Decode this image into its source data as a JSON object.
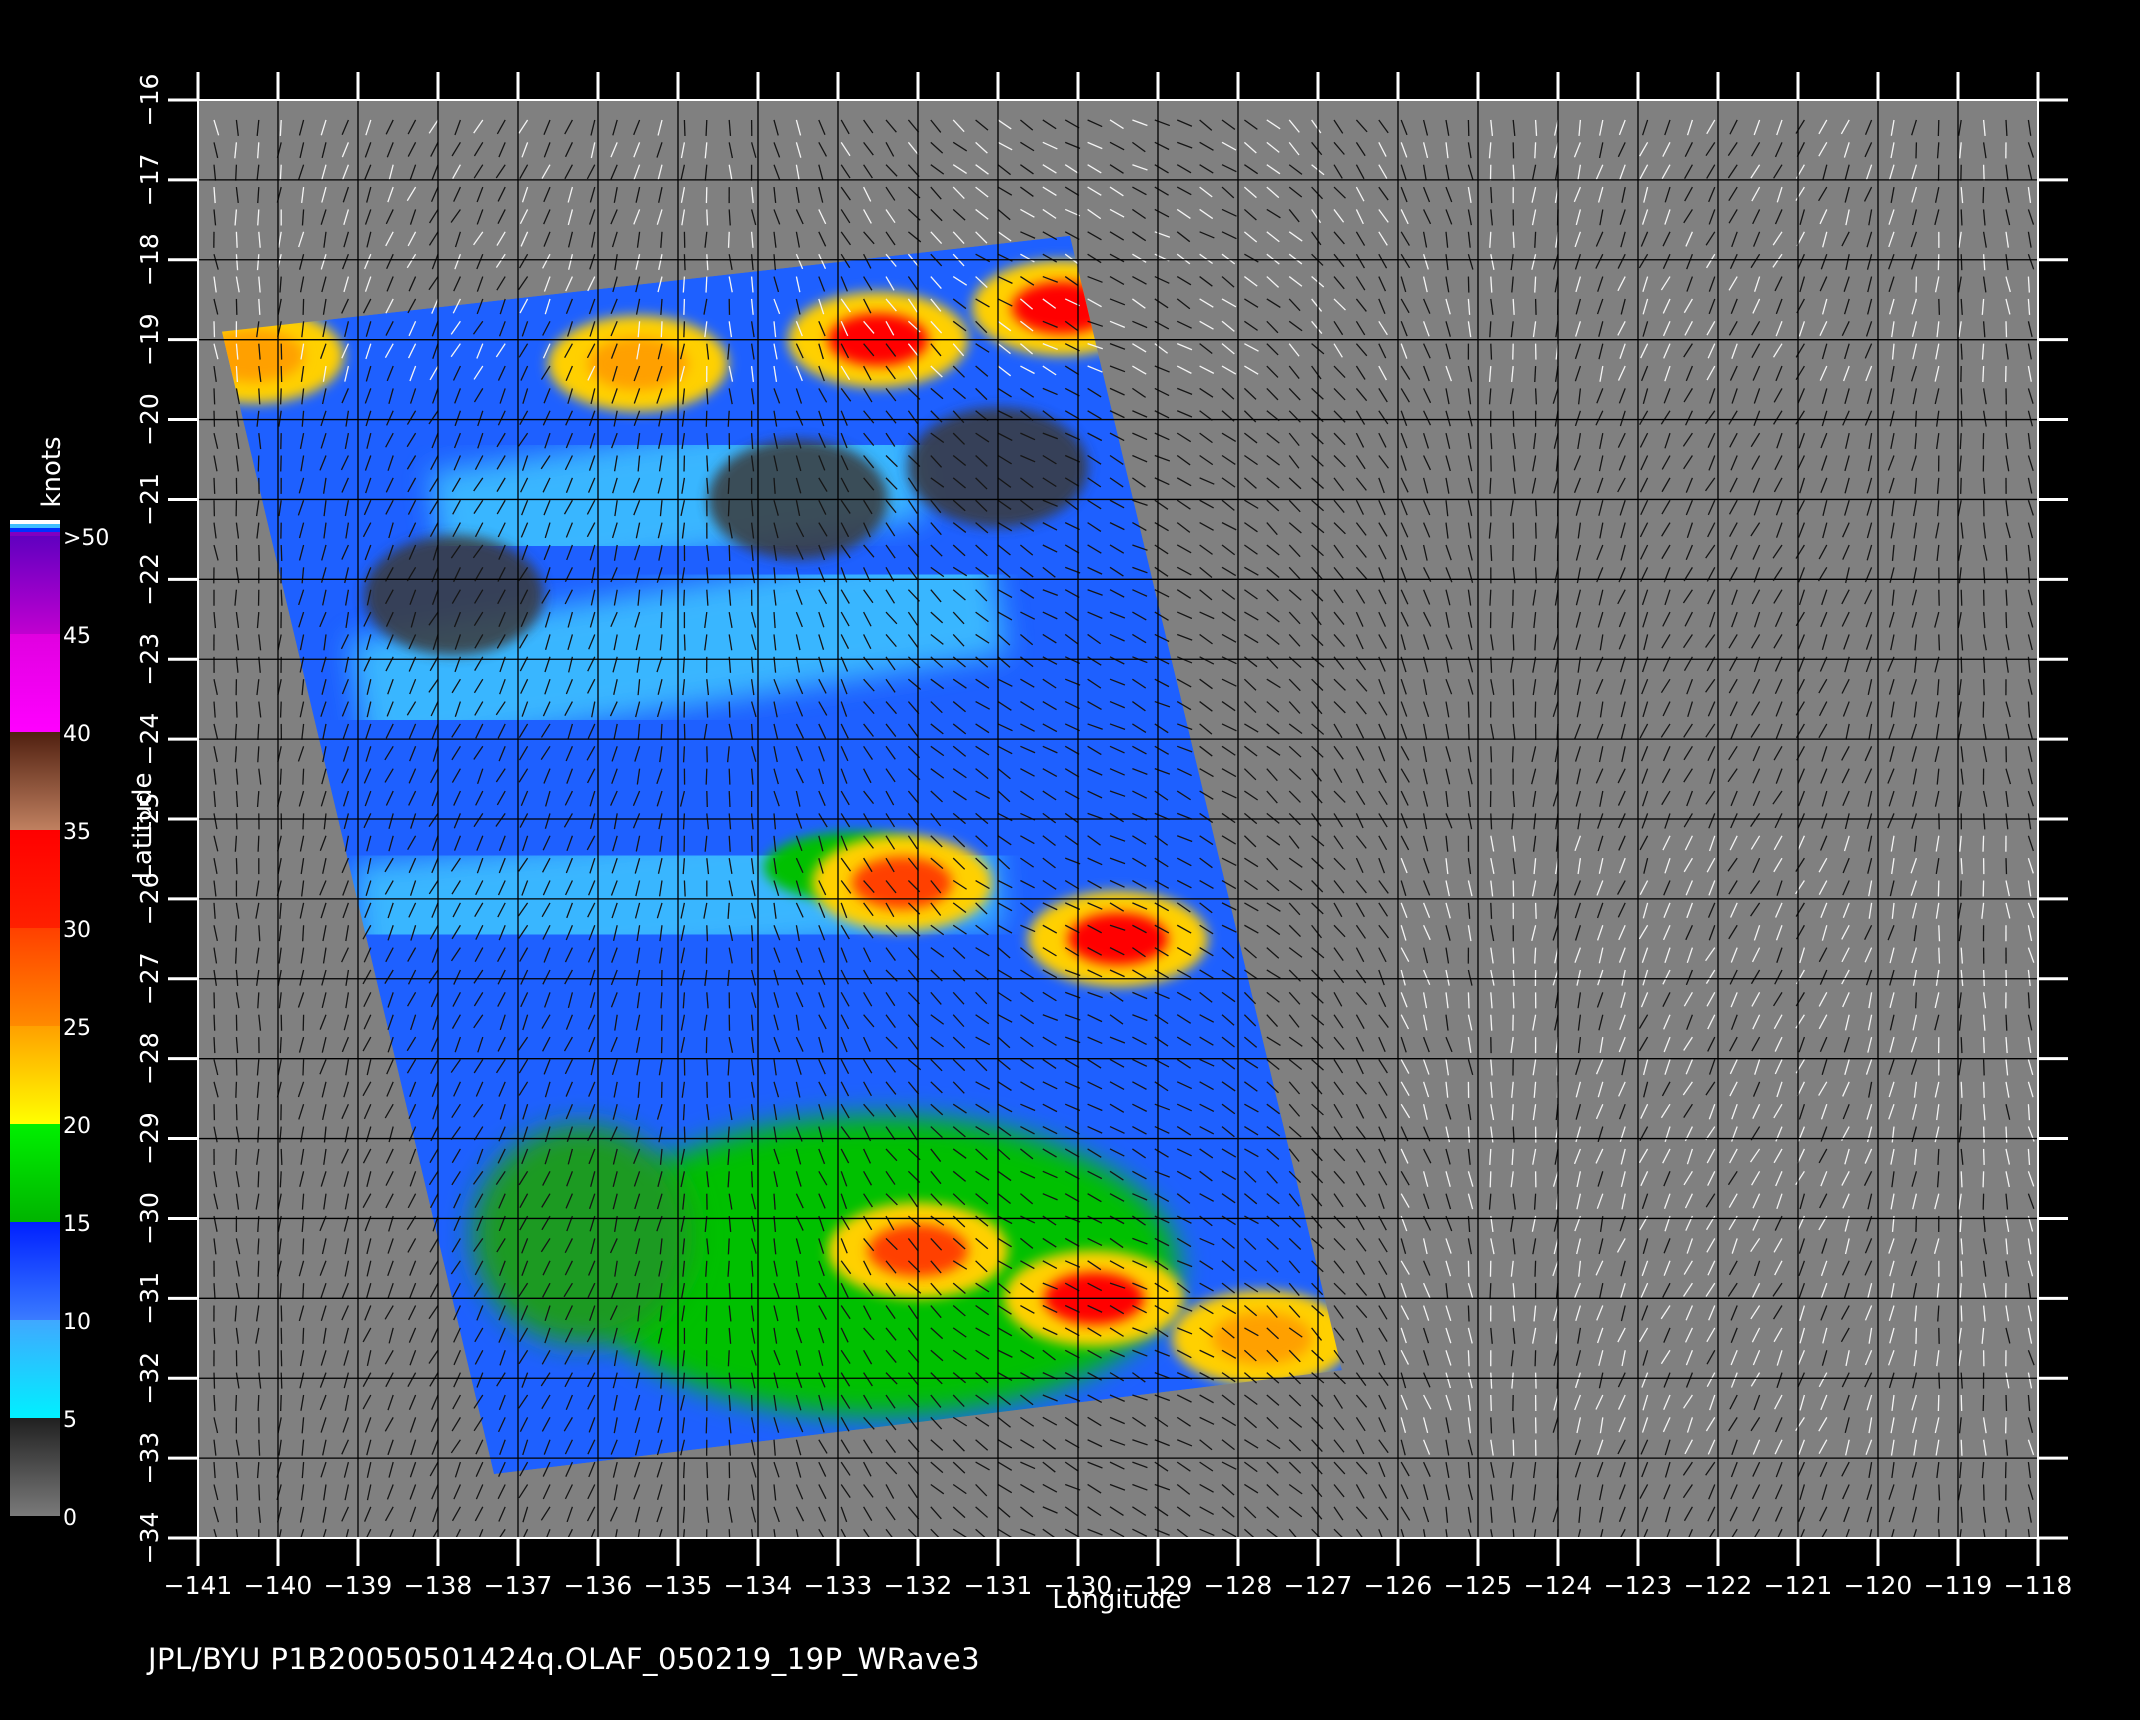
{
  "colorbar": {
    "unit_label": "knots",
    "tick_labels": [
      "0",
      "5",
      "10",
      "15",
      "20",
      "25",
      "30",
      "35",
      "40",
      "45",
      ">50"
    ],
    "bands": [
      {
        "from": 0,
        "to": 5,
        "colors": [
          "#7a7a7a",
          "#202020"
        ]
      },
      {
        "from": 5,
        "to": 10,
        "colors": [
          "#00f0ff",
          "#40a8ff"
        ]
      },
      {
        "from": 10,
        "to": 15,
        "colors": [
          "#3a7bff",
          "#0020ff"
        ]
      },
      {
        "from": 15,
        "to": 20,
        "colors": [
          "#00b400",
          "#00f000"
        ]
      },
      {
        "from": 20,
        "to": 25,
        "colors": [
          "#ffff00",
          "#ffa000"
        ]
      },
      {
        "from": 25,
        "to": 30,
        "colors": [
          "#ff8a00",
          "#ff4000"
        ]
      },
      {
        "from": 30,
        "to": 35,
        "colors": [
          "#ff2000",
          "#ff0000"
        ]
      },
      {
        "from": 35,
        "to": 40,
        "colors": [
          "#c08060",
          "#502010"
        ]
      },
      {
        "from": 40,
        "to": 45,
        "colors": [
          "#ff00ff",
          "#e000e0"
        ]
      },
      {
        "from": 45,
        "to": 50,
        "colors": [
          "#c000d0",
          "#6000c0"
        ]
      }
    ],
    "cap_colors": [
      "#ffffff",
      "#40c0ff",
      "#0030ff",
      "#8000c0"
    ]
  },
  "chart_data": {
    "type": "heatmap",
    "x_axis": {
      "label": "Longitude",
      "min": -141,
      "max": -118,
      "step": 1,
      "tick_labels": [
        "−141",
        "−140",
        "−139",
        "−138",
        "−137",
        "−136",
        "−135",
        "−134",
        "−133",
        "−132",
        "−131",
        "−130",
        "−129",
        "−128",
        "−127",
        "−126",
        "−125",
        "−124",
        "−123",
        "−122",
        "−121",
        "−120",
        "−119",
        "−118"
      ]
    },
    "y_axis": {
      "label": "Latitude",
      "min": -34,
      "max": -16,
      "step": 1,
      "tick_labels": [
        "−16",
        "−17",
        "−18",
        "−19",
        "−20",
        "−21",
        "−22",
        "−23",
        "−24",
        "−25",
        "−26",
        "−27",
        "−28",
        "−29",
        "−30",
        "−31",
        "−32",
        "−33",
        "−34"
      ]
    },
    "grid": true,
    "background_color": "#808080",
    "swath_corners": [
      [
        -140.7,
        -18.9
      ],
      [
        -130.1,
        -17.7
      ],
      [
        -126.7,
        -31.9
      ],
      [
        -137.3,
        -33.2
      ]
    ],
    "high_wind_areas": [
      {
        "lon": -132.5,
        "lat": -19.0,
        "speed": 30
      },
      {
        "lon": -130.2,
        "lat": -18.6,
        "speed": 30
      },
      {
        "lon": -135.5,
        "lat": -19.3,
        "speed": 22
      },
      {
        "lon": -140.3,
        "lat": -19.2,
        "speed": 24
      },
      {
        "lon": -132.2,
        "lat": -25.8,
        "speed": 28
      },
      {
        "lon": -129.5,
        "lat": -26.5,
        "speed": 30
      },
      {
        "lon": -132.0,
        "lat": -30.4,
        "speed": 28
      },
      {
        "lon": -129.8,
        "lat": -31.0,
        "speed": 30
      },
      {
        "lon": -127.7,
        "lat": -31.5,
        "speed": 24
      }
    ],
    "calm_areas": [
      {
        "lon": -137.8,
        "lat": -22.2
      },
      {
        "lon": -133.5,
        "lat": -21.0
      },
      {
        "lon": -131.0,
        "lat": -20.6
      }
    ]
  },
  "footer": {
    "text": "JPL/BYU  P1B20050501424q.OLAF_050219_19P_WRave3"
  }
}
